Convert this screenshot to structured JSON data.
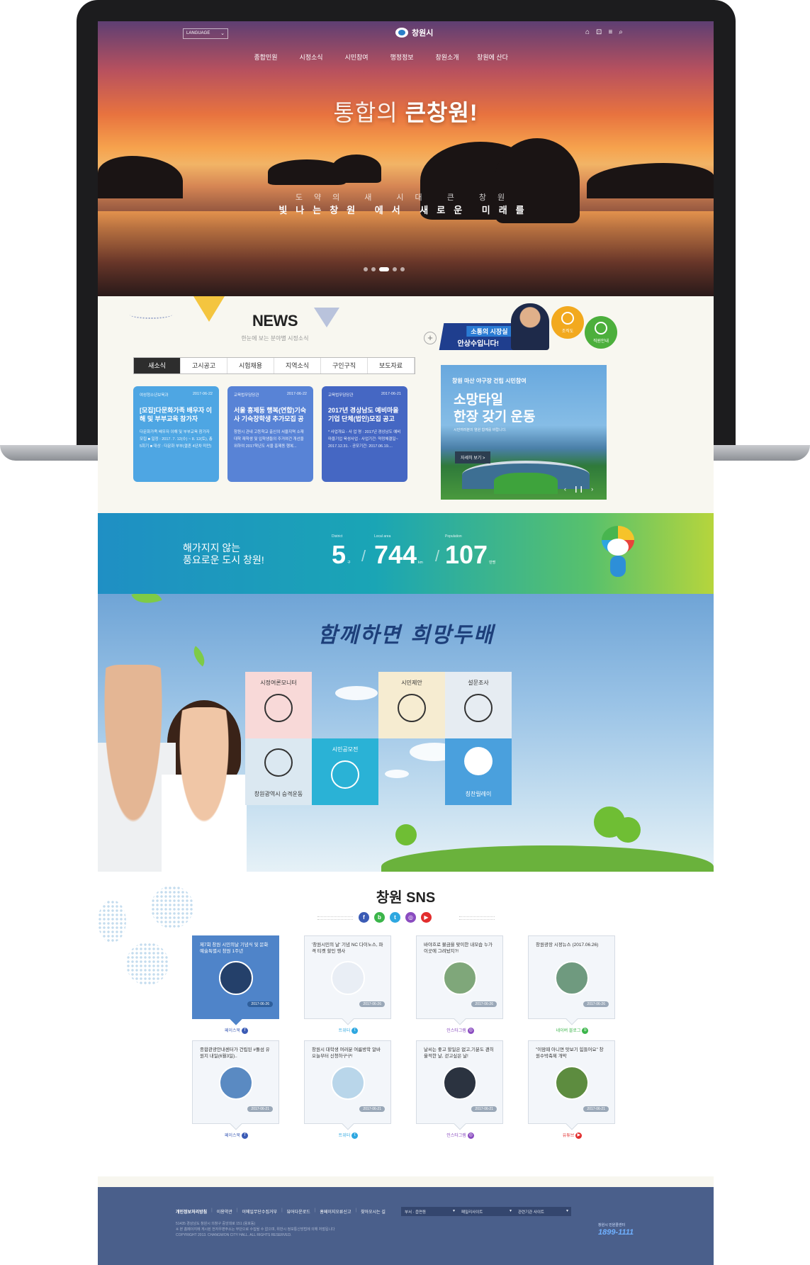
{
  "header": {
    "language_label": "LANGUAGE",
    "logo_text": "창원시",
    "nav": [
      "종합민원",
      "시정소식",
      "시민참여",
      "행정정보",
      "창원소개",
      "창원에 산다"
    ]
  },
  "hero": {
    "title_light": "통합의 ",
    "title_bold": "큰창원!",
    "sub_small": "도약의 새 시대 큰 창원",
    "sub_large": "빛나는창원 에서 새로운 미래를"
  },
  "news": {
    "title": "NEWS",
    "subtitle": "한눈에 보는 분야별 시정소식",
    "plus": "+",
    "tabs": [
      "새소식",
      "고시공고",
      "시험채용",
      "지역소식",
      "구인구직",
      "보도자료"
    ],
    "cards": [
      {
        "dept": "여성청소년보육과",
        "date": "2017-06-22",
        "title": "[모집]다문화가족 배우자 이해 및 부부교육 참가자",
        "body": "다문화가족 배우자 이해 및 부부교육 참가자 모집 ■ 일정 : 2017. 7. 12(수) ~ 8. 12(토), 총 5회기 ■ 대상 : 다문화 부부(결혼 4년차 미만)"
      },
      {
        "dept": "교육법무담당관",
        "date": "2017-06-22",
        "title": "서울 흥제동 행복(연합)기숙사 기숙장학생 추가모집 공고",
        "body": "창원시 관내 고등학교 출신의 서울지역 소재 대학 재학생 및 입학생들의 주거여건 개선을 위하여 2017학년도 서울 흥제동 행복..."
      },
      {
        "dept": "교육법무담당관",
        "date": "2017-06-21",
        "title": "2017년 경상남도 예비마을기업 단체(법인)모집 공고",
        "body": "* 사업개요 - 사 업 명 : 2017년 경상남도 예비마을기업 육성사업 - 사업기간: 약정체결일~ 2017.12.31. - 공모기간: 2017.06.19...."
      }
    ]
  },
  "mayor": {
    "line1": "소통의 시장실",
    "line2": "안상수입니다!",
    "org_label": "조직도",
    "staff_label": "직원안내"
  },
  "promo": {
    "tag": "창원 마산 야구장 건립 시민참여",
    "headline_1": "소망타일",
    "headline_2": "한장 갖기 운동",
    "small": "시민여러분의 염원 함께를 바랍니다.",
    "more": "자세히 보기 >",
    "prev": "‹",
    "pause": "❙❙",
    "next": "›"
  },
  "stats": {
    "motto_1": "해가지지 않는",
    "motto_2": "풍요로운 도시 창원!",
    "items": [
      {
        "label": "District",
        "value": "5",
        "unit": "구"
      },
      {
        "label": "Local area",
        "value": "744",
        "unit": "km"
      },
      {
        "label": "Population",
        "value": "107",
        "unit": "만명"
      }
    ]
  },
  "participation": {
    "headline": "함께하면 희망두배",
    "tiles": [
      "시정여론모니터",
      "시민제안",
      "설문조사",
      "창원광역시 승격운동",
      "시민공모전",
      "칭찬릴레이"
    ]
  },
  "sns": {
    "title": "창원 SNS",
    "icons": [
      "f",
      "b",
      "t",
      "◎",
      "▶"
    ],
    "cards": [
      {
        "title": "제7회 창원 시민의날 기념식 및 문화예술특별시 창원 1주년",
        "date": "2017-06-26",
        "source": "페이스북"
      },
      {
        "title": "'창원시민의 날' 기념 NC 다이노스, 파격 티켓 할인 행사",
        "date": "2017-06-26",
        "source": "트위터"
      },
      {
        "title": "바야흐로 불금을 맞이한 내모습 누가 이곳에 그려놨지?!",
        "date": "2017-06-26",
        "source": "인스타그램"
      },
      {
        "title": "창원광장 시정뉴스 (2017.06.26)",
        "date": "2017-06-26",
        "source": "네이버 블로그"
      },
      {
        "title": "종합관광안내센터가 건립된 #돌섬 유원지 내일(6월3일)..",
        "date": "2017-06-21",
        "source": "페이스북"
      },
      {
        "title": "창원시 대학생 여러분 여름방학 알바 오늘부터 신청하구구!",
        "date": "2017-06-21",
        "source": "트위터"
      },
      {
        "title": "날씨는 좋고 할일은 없고,기분도 괜히 울적한 날, 걷고싶은 날!",
        "date": "2017-06-21",
        "source": "인스타그램"
      },
      {
        "title": "\"이맘때 아니면 맛보기 힘들어요\" 창원수박축제 개막",
        "date": "2017-06-21",
        "source": "유튜브"
      }
    ]
  },
  "footer": {
    "links": [
      "개인정보처리방침",
      "이용약관",
      "이메일무단수집거부",
      "뷰어다운로드",
      "홈페이지오류신고",
      "찾아오시는 길"
    ],
    "address": "51435 경상남도 창원시 의창구 중앙대로 151 (용호동)",
    "notice": "※ 본 홈페이지에 게시된 전자우편주소는 무단으로 수집될 수 없으며, 위반시 정보통신망법에 의해 처벌됩니다",
    "copyright": "COPYRIGHT 2013. CHANGWON CITY HALL. ALL RIGHTS RESERVED.",
    "selects": [
      "부서 · 읍면동",
      "패밀리사이트",
      "관련기관 사이트"
    ],
    "call_label": "창원시 민원콜센터",
    "call_number": "1899-1111"
  }
}
